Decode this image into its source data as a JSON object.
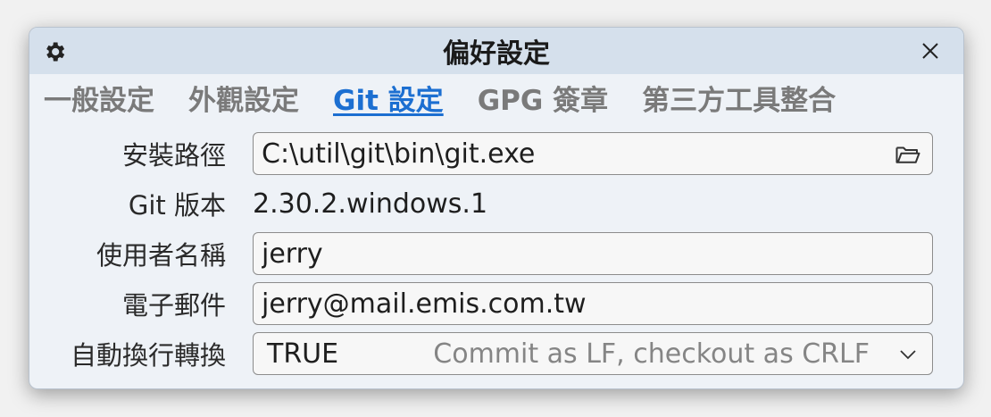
{
  "dialog": {
    "title": "偏好設定"
  },
  "tabs": [
    {
      "label": "一般設定",
      "active": false
    },
    {
      "label": "外觀設定",
      "active": false
    },
    {
      "label": "Git 設定",
      "active": true
    },
    {
      "label": "GPG 簽章",
      "active": false
    },
    {
      "label": "第三方工具整合",
      "active": false
    }
  ],
  "form": {
    "install_path": {
      "label": "安裝路徑",
      "value": "C:\\util\\git\\bin\\git.exe"
    },
    "git_version": {
      "label": "Git 版本",
      "value": "2.30.2.windows.1"
    },
    "user_name": {
      "label": "使用者名稱",
      "value": "jerry"
    },
    "email": {
      "label": "電子郵件",
      "value": "jerry@mail.emis.com.tw"
    },
    "autocrlf": {
      "label": "自動換行轉換",
      "value": "TRUE",
      "hint": "Commit as LF, checkout as CRLF"
    }
  },
  "colors": {
    "accent": "#1c6fd1",
    "titlebar": "#d5e0ec",
    "dialog_bg": "#eef2f7"
  },
  "icons": {
    "title": "gear-icon",
    "close": "close-icon",
    "browse": "folder-icon",
    "dropdown": "chevron-down-icon"
  }
}
